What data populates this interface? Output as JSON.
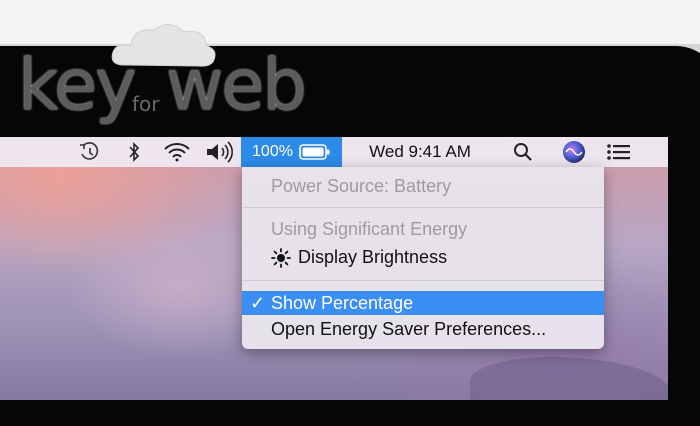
{
  "logo": {
    "part1": "key",
    "part2": "for",
    "part3": "web"
  },
  "menubar": {
    "icons": [
      "time-machine-icon",
      "bluetooth-icon",
      "wifi-icon",
      "volume-icon",
      "spotlight-search-icon",
      "siri-icon",
      "notification-center-icon"
    ],
    "battery_percent": "100%",
    "clock": "Wed 9:41 AM"
  },
  "battery_menu": {
    "power_source": "Power Source: Battery",
    "energy_heading": "Using Significant Energy",
    "energy_app": "Display Brightness",
    "check_mark": "✓",
    "show_percentage": "Show Percentage",
    "energy_saver": "Open Energy Saver Preferences..."
  },
  "colors": {
    "highlight": "#3b8ef3",
    "battery_active": "#2d8ae8",
    "menubar": "#eee8f0"
  }
}
